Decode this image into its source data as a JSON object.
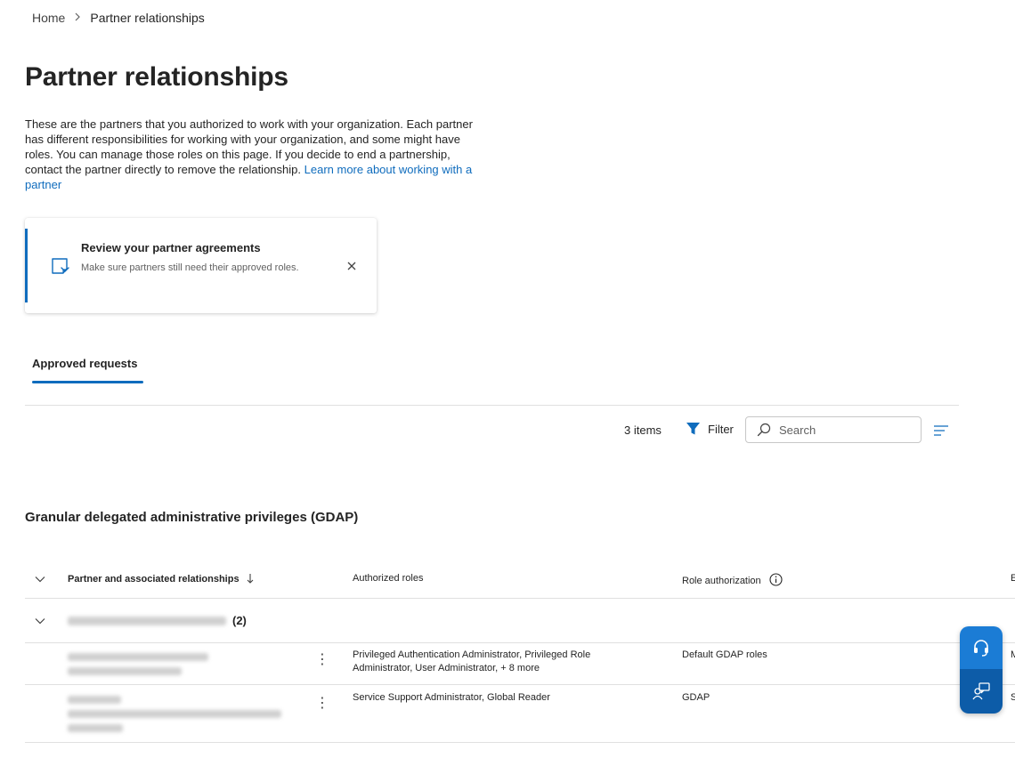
{
  "breadcrumb": {
    "home": "Home",
    "current": "Partner relationships"
  },
  "page": {
    "title": "Partner relationships",
    "description": "These are the partners that you authorized to work with your organization. Each partner has different responsibilities for working with your organization, and some might have roles. You can manage those roles on this page. If you decide to end a partnership, contact the partner directly to remove the relationship.",
    "learn_more": "Learn more about working with a partner"
  },
  "notice": {
    "title": "Review your partner agreements",
    "body": "Make sure partners still need their approved roles.",
    "icon": "document-review-icon"
  },
  "tabs": [
    {
      "label": "Approved requests",
      "selected": true
    }
  ],
  "toolbar": {
    "count": "3 items",
    "filter_label": "Filter",
    "search_placeholder": "Search"
  },
  "section": {
    "title": "Granular delegated administrative privileges (GDAP)"
  },
  "table": {
    "headers": {
      "partner": "Partner and associated relationships",
      "roles": "Authorized roles",
      "authorization": "Role authorization",
      "extra": "E"
    },
    "group": {
      "count": "(2)"
    },
    "rows": [
      {
        "roles": "Privileged Authentication Administrator, Privileged Role Administrator, User Administrator, + 8 more",
        "authorization": "Default GDAP roles",
        "extra": "M"
      },
      {
        "roles": "Service Support Administrator, Global Reader",
        "authorization": "GDAP",
        "extra": "S"
      }
    ]
  },
  "colors": {
    "accent": "#0f6cbd",
    "fab_top": "#1b7cd5",
    "fab_bottom": "#0d5ca8"
  }
}
